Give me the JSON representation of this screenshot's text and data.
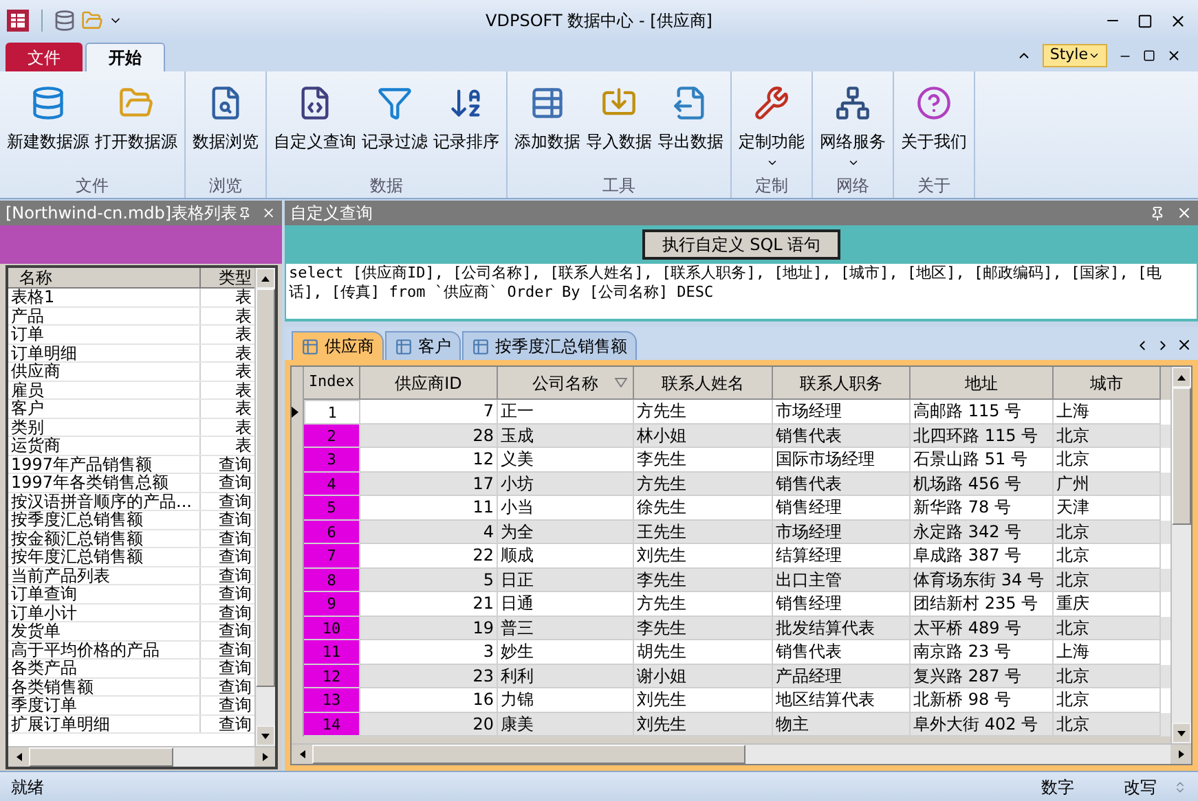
{
  "window": {
    "title": "VDPSOFT 数据中心 - [供应商]"
  },
  "ribbon_tabs": [
    {
      "label": "文件",
      "kind": "file",
      "selected": false
    },
    {
      "label": "开始",
      "kind": "tab",
      "selected": true
    }
  ],
  "style_button": {
    "label": "Style"
  },
  "ribbon_groups": [
    {
      "label": "文件",
      "buttons": [
        {
          "label": "新建数据源",
          "has_menu": false
        },
        {
          "label": "打开数据源",
          "has_menu": false
        }
      ]
    },
    {
      "label": "浏览",
      "buttons": [
        {
          "label": "数据浏览",
          "has_menu": false
        }
      ]
    },
    {
      "label": "数据",
      "buttons": [
        {
          "label": "自定义查询",
          "has_menu": false
        },
        {
          "label": "记录过滤",
          "has_menu": false
        },
        {
          "label": "记录排序",
          "has_menu": false
        }
      ]
    },
    {
      "label": "工具",
      "buttons": [
        {
          "label": "添加数据",
          "has_menu": false
        },
        {
          "label": "导入数据",
          "has_menu": false
        },
        {
          "label": "导出数据",
          "has_menu": false
        }
      ]
    },
    {
      "label": "定制",
      "buttons": [
        {
          "label": "定制功能",
          "has_menu": true
        }
      ]
    },
    {
      "label": "网络",
      "buttons": [
        {
          "label": "网络服务",
          "has_menu": true
        }
      ]
    },
    {
      "label": "关于",
      "buttons": [
        {
          "label": "关于我们",
          "has_menu": false
        }
      ]
    }
  ],
  "tables_panel": {
    "title": "[Northwind-cn.mdb]表格列表",
    "columns": [
      "名称",
      "类型"
    ],
    "rows": [
      {
        "name": "表格1",
        "type": "表"
      },
      {
        "name": "产品",
        "type": "表"
      },
      {
        "name": "订单",
        "type": "表"
      },
      {
        "name": "订单明细",
        "type": "表"
      },
      {
        "name": "供应商",
        "type": "表"
      },
      {
        "name": "雇员",
        "type": "表"
      },
      {
        "name": "客户",
        "type": "表"
      },
      {
        "name": "类别",
        "type": "表"
      },
      {
        "name": "运货商",
        "type": "表"
      },
      {
        "name": "1997年产品销售额",
        "type": "查询"
      },
      {
        "name": "1997年各类销售总额",
        "type": "查询"
      },
      {
        "name": "按汉语拼音顺序的产品...",
        "type": "查询"
      },
      {
        "name": "按季度汇总销售额",
        "type": "查询"
      },
      {
        "name": "按金额汇总销售额",
        "type": "查询"
      },
      {
        "name": "按年度汇总销售额",
        "type": "查询"
      },
      {
        "name": "当前产品列表",
        "type": "查询"
      },
      {
        "name": "订单查询",
        "type": "查询"
      },
      {
        "name": "订单小计",
        "type": "查询"
      },
      {
        "name": "发货单",
        "type": "查询"
      },
      {
        "name": "高于平均价格的产品",
        "type": "查询"
      },
      {
        "name": "各类产品",
        "type": "查询"
      },
      {
        "name": "各类销售额",
        "type": "查询"
      },
      {
        "name": "季度订单",
        "type": "查询"
      },
      {
        "name": "扩展订单明细",
        "type": "查询"
      }
    ]
  },
  "query_panel": {
    "title": "自定义查询",
    "run_button": "执行自定义 SQL 语句",
    "sql": "select [供应商ID], [公司名称], [联系人姓名], [联系人职务], [地址], [城市], [地区], [邮政编码], [国家], [电话], [传真] from `供应商` Order By [公司名称] DESC"
  },
  "document_tabs": [
    {
      "label": "供应商",
      "selected": true
    },
    {
      "label": "客户",
      "selected": false
    },
    {
      "label": "按季度汇总销售额",
      "selected": false
    }
  ],
  "grid": {
    "columns": [
      "Index",
      "供应商ID",
      "公司名称",
      "联系人姓名",
      "联系人职务",
      "地址",
      "城市"
    ],
    "rows": [
      {
        "selected": true,
        "cells": [
          "1",
          "7",
          "正一",
          "方先生",
          "市场经理",
          "高邮路 115 号",
          "上海"
        ]
      },
      {
        "selected": false,
        "cells": [
          "2",
          "28",
          "玉成",
          "林小姐",
          "销售代表",
          "北四环路 115 号",
          "北京"
        ]
      },
      {
        "selected": false,
        "cells": [
          "3",
          "12",
          "义美",
          "李先生",
          "国际市场经理",
          "石景山路 51 号",
          "北京"
        ]
      },
      {
        "selected": false,
        "cells": [
          "4",
          "17",
          "小坊",
          "方先生",
          "销售代表",
          "机场路 456 号",
          "广州"
        ]
      },
      {
        "selected": false,
        "cells": [
          "5",
          "11",
          "小当",
          "徐先生",
          "销售经理",
          "新华路 78 号",
          "天津"
        ]
      },
      {
        "selected": false,
        "cells": [
          "6",
          "4",
          "为全",
          "王先生",
          "市场经理",
          "永定路 342 号",
          "北京"
        ]
      },
      {
        "selected": false,
        "cells": [
          "7",
          "22",
          "顺成",
          "刘先生",
          "结算经理",
          "阜成路 387 号",
          "北京"
        ]
      },
      {
        "selected": false,
        "cells": [
          "8",
          "5",
          "日正",
          "李先生",
          "出口主管",
          "体育场东街 34 号",
          "北京"
        ]
      },
      {
        "selected": false,
        "cells": [
          "9",
          "21",
          "日通",
          "方先生",
          "销售经理",
          "团结新村 235 号",
          "重庆"
        ]
      },
      {
        "selected": false,
        "cells": [
          "10",
          "19",
          "普三",
          "李先生",
          "批发结算代表",
          "太平桥 489 号",
          "北京"
        ]
      },
      {
        "selected": false,
        "cells": [
          "11",
          "3",
          "妙生",
          "胡先生",
          "销售代表",
          "南京路 23 号",
          "上海"
        ]
      },
      {
        "selected": false,
        "cells": [
          "12",
          "23",
          "利利",
          "谢小姐",
          "产品经理",
          "复兴路 287 号",
          "北京"
        ]
      },
      {
        "selected": false,
        "cells": [
          "13",
          "16",
          "力锦",
          "刘先生",
          "地区结算代表",
          "北新桥 98 号",
          "北京"
        ]
      },
      {
        "selected": false,
        "cells": [
          "14",
          "20",
          "康美",
          "刘先生",
          "物主",
          "阜外大街 402 号",
          "北京"
        ]
      }
    ]
  },
  "status_bar": {
    "left": "就绪",
    "items": [
      "数字",
      "改写"
    ]
  }
}
